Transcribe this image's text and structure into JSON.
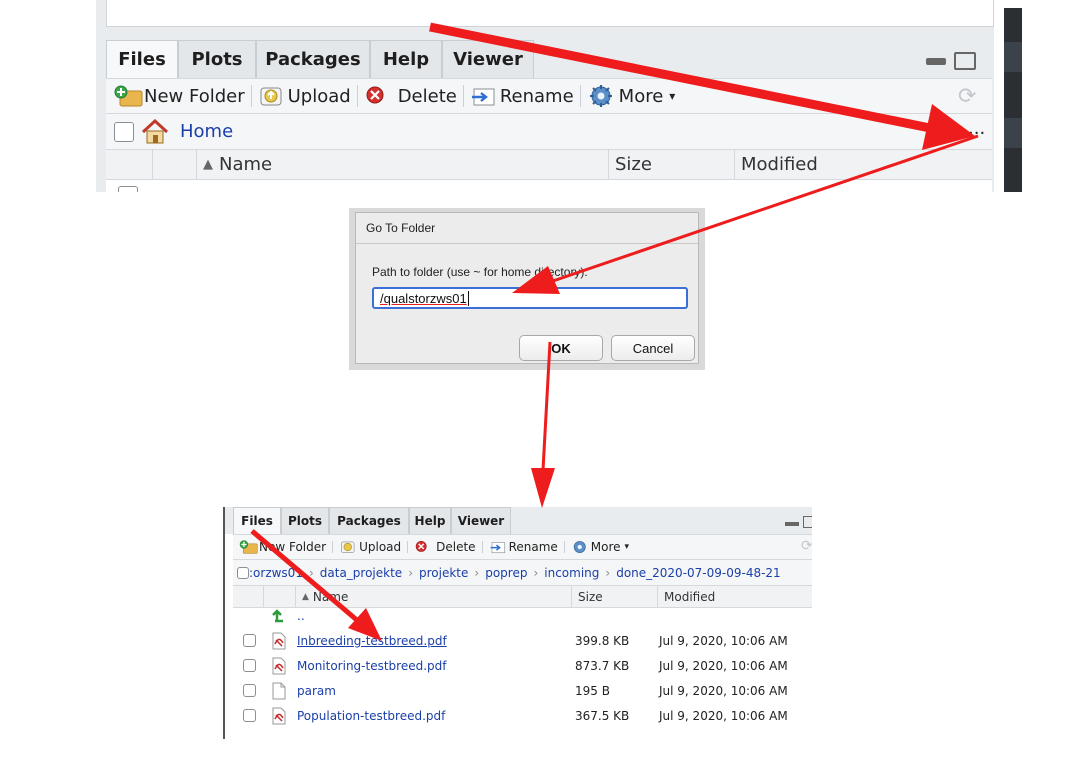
{
  "top_pane": {
    "tabs": [
      {
        "label": "Files",
        "active": true
      },
      {
        "label": "Plots",
        "active": false
      },
      {
        "label": "Packages",
        "active": false
      },
      {
        "label": "Help",
        "active": false
      },
      {
        "label": "Viewer",
        "active": false
      }
    ],
    "toolbar": {
      "new_folder": "New Folder",
      "upload": "Upload",
      "delete": "Delete",
      "rename": "Rename",
      "more": "More",
      "more_caret": "▾"
    },
    "path": {
      "home": "Home",
      "ellipsis": "..."
    },
    "columns": {
      "name": "Name",
      "size": "Size",
      "modified": "Modified"
    }
  },
  "dialog": {
    "title": "Go To Folder",
    "prompt": "Path to folder (use ~ for home directory):",
    "input_value": "/qualstorzws01",
    "ok_label": "OK",
    "cancel_label": "Cancel"
  },
  "bottom_pane": {
    "tabs": [
      {
        "label": "Files",
        "active": true
      },
      {
        "label": "Plots",
        "active": false
      },
      {
        "label": "Packages",
        "active": false
      },
      {
        "label": "Help",
        "active": false
      },
      {
        "label": "Viewer",
        "active": false
      }
    ],
    "toolbar": {
      "new_folder": "New Folder",
      "upload": "Upload",
      "delete": "Delete",
      "rename": "Rename",
      "more": "More",
      "more_caret": "▾"
    },
    "breadcrumb": [
      ":orzws01",
      "data_projekte",
      "projekte",
      "poprep",
      "incoming",
      "done_2020-07-09-09-48-21"
    ],
    "columns": {
      "name": "Name",
      "size": "Size",
      "modified": "Modified"
    },
    "parent_dir": "..",
    "files": [
      {
        "name": "Inbreeding-testbreed.pdf",
        "size": "399.8 KB",
        "modified": "Jul 9, 2020, 10:06 AM",
        "type": "pdf",
        "visited": true
      },
      {
        "name": "Monitoring-testbreed.pdf",
        "size": "873.7 KB",
        "modified": "Jul 9, 2020, 10:06 AM",
        "type": "pdf",
        "visited": false
      },
      {
        "name": "param",
        "size": "195 B",
        "modified": "Jul 9, 2020, 10:06 AM",
        "type": "file",
        "visited": false
      },
      {
        "name": "Population-testbreed.pdf",
        "size": "367.5 KB",
        "modified": "Jul 9, 2020, 10:06 AM",
        "type": "pdf",
        "visited": false
      }
    ]
  },
  "colors": {
    "annotation_arrow": "#ee1c1c",
    "link": "#1a3fa8",
    "input_focus": "#3b6fd6"
  },
  "icons": [
    "new-folder-icon",
    "upload-icon",
    "delete-icon",
    "rename-icon",
    "gear-icon",
    "home-icon",
    "refresh-icon",
    "pdf-file-icon",
    "file-icon",
    "parent-folder-arrow-icon",
    "sort-up-icon"
  ]
}
